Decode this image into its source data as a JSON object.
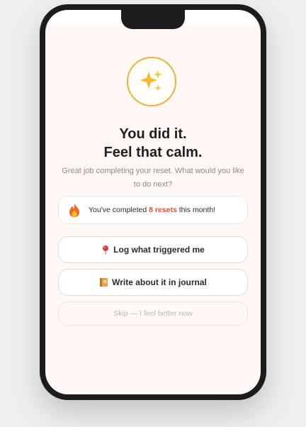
{
  "icons": {
    "badge": "sparkles-icon",
    "streak": "fire-icon",
    "log": "pin-icon",
    "journal": "journal-book-icon"
  },
  "colors": {
    "accent_gold": "#e9b33a",
    "streak_highlight": "#e2502e",
    "screen_background": "#fff8f4"
  },
  "content": {
    "title_line1": "You did it.",
    "title_line2": "Feel that calm.",
    "subtitle": "Great job completing your reset. What would you like to do next?"
  },
  "streak": {
    "prefix": "You've completed ",
    "count": "8 resets",
    "suffix": " this month!"
  },
  "actions": {
    "log_label": "Log what triggered me",
    "journal_label": "Write about it in journal",
    "skip_label": "Skip — I feel better now"
  }
}
